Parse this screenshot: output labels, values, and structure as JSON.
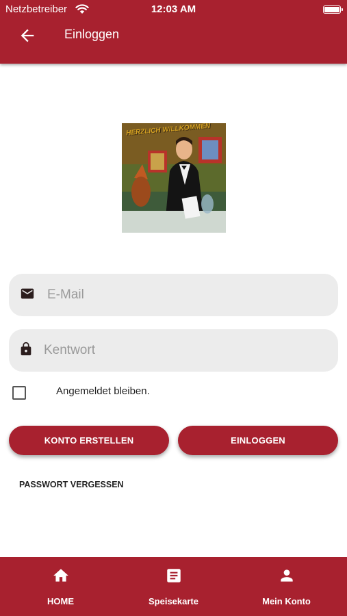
{
  "status_bar": {
    "carrier": "Netzbetreiber",
    "time": "12:03 AM",
    "icons": [
      "wifi-icon",
      "battery-icon"
    ]
  },
  "app_bar": {
    "title": "Einloggen",
    "back_icon": "arrow-left-icon"
  },
  "logo": {
    "caption": "HERZLICH WILLKOMMEN"
  },
  "form": {
    "email": {
      "placeholder": "E-Mail",
      "value": "",
      "icon": "mail-icon"
    },
    "password": {
      "placeholder": "Kentwort",
      "value": "",
      "icon": "lock-icon"
    },
    "remember_me": {
      "label": "Angemeldet bleiben.",
      "checked": false
    },
    "register_button": "KONTO ERSTELLEN",
    "login_button": "EINLOGGEN",
    "forgot_password": "PASSWORT VERGESSEN"
  },
  "bottom_nav": {
    "items": [
      {
        "label": "HOME",
        "icon": "home-icon"
      },
      {
        "label": "Speisekarte",
        "icon": "menu-list-icon"
      },
      {
        "label": "Mein Konto",
        "icon": "person-icon"
      }
    ]
  },
  "colors": {
    "primary": "#a8212f",
    "field_bg": "#ececec",
    "placeholder": "#9a9a9a"
  }
}
